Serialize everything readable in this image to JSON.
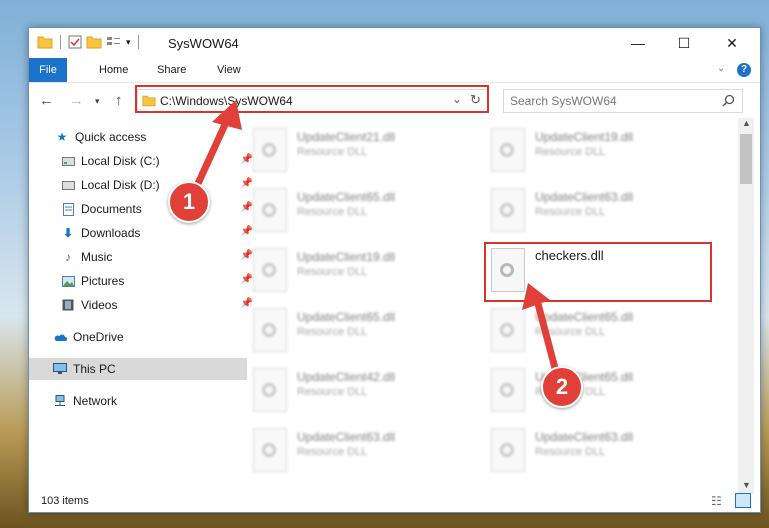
{
  "titlebar": {
    "title": "SysWOW64",
    "minimize": "—",
    "maximize": "☐",
    "close": "✕"
  },
  "ribbon": {
    "tabs": [
      "File",
      "Home",
      "Share",
      "View"
    ],
    "help": "?"
  },
  "address": {
    "path": "C:\\Windows\\SysWOW64",
    "search_placeholder": "Search SysWOW64"
  },
  "nav": {
    "items": [
      {
        "label": "Quick access",
        "icon": "star-icon"
      },
      {
        "label": "Local Disk (C:)",
        "icon": "drive-icon"
      },
      {
        "label": "Local Disk (D:)",
        "icon": "drive-icon"
      },
      {
        "label": "Documents",
        "icon": "documents-icon"
      },
      {
        "label": "Downloads",
        "icon": "download-icon"
      },
      {
        "label": "Music",
        "icon": "music-icon"
      },
      {
        "label": "Pictures",
        "icon": "pictures-icon"
      },
      {
        "label": "Videos",
        "icon": "videos-icon"
      },
      {
        "label": "OneDrive",
        "icon": "cloud-icon"
      },
      {
        "label": "This PC",
        "icon": "computer-icon"
      },
      {
        "label": "Network",
        "icon": "network-icon"
      }
    ]
  },
  "files": [
    {
      "name": "UpdateClient21.dll",
      "type": "Resource DLL"
    },
    {
      "name": "UpdateClient19.dll",
      "type": "Resource DLL"
    },
    {
      "name": "UpdateClient65.dll",
      "type": "Resource DLL"
    },
    {
      "name": "UpdateClient63.dll",
      "type": "Resource DLL"
    },
    {
      "name": "UpdateClient19.dll",
      "type": "Resource DLL"
    },
    {
      "name": "checkers.dll",
      "type": ""
    },
    {
      "name": "UpdateClient65.dll",
      "type": "Resource DLL"
    },
    {
      "name": "UpdateClient65.dll",
      "type": "Resource DLL"
    },
    {
      "name": "UpdateClient42.dll",
      "type": "Resource DLL"
    },
    {
      "name": "UpdateClient65.dll",
      "type": "Resource DLL"
    },
    {
      "name": "UpdateClient63.dll",
      "type": "Resource DLL"
    },
    {
      "name": "UpdateClient63.dll",
      "type": "Resource DLL"
    }
  ],
  "status": {
    "count": "103 items"
  },
  "callouts": {
    "one": "1",
    "two": "2"
  },
  "colors": {
    "accent": "#1a73c9",
    "highlight": "#d9342b"
  }
}
